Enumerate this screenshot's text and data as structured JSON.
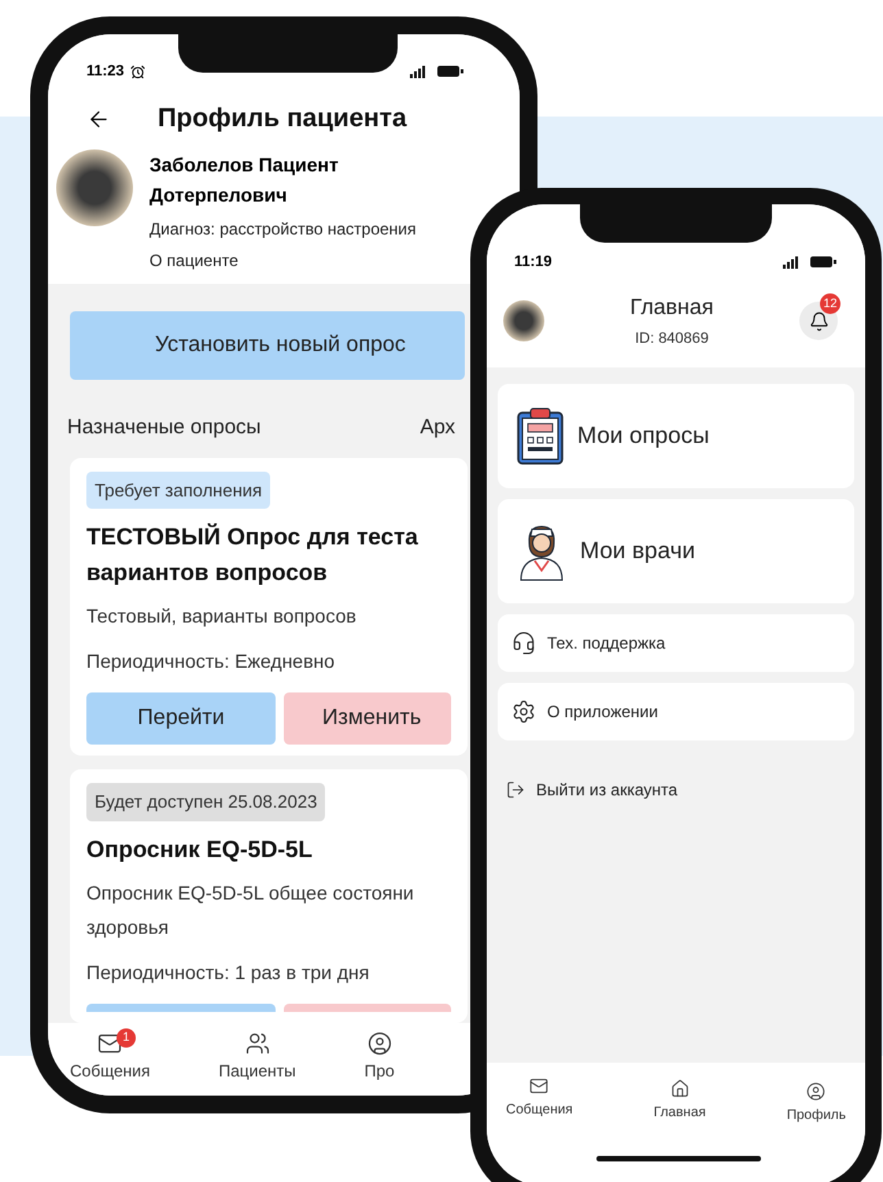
{
  "back_phone": {
    "status_time": "11:23",
    "title": "Профиль пациента",
    "patient": {
      "name": "Заболелов Пациент Дотерпелович",
      "diagnosis": "Диагноз: расстройство настроения",
      "about_link": "О пациенте"
    },
    "new_survey_button": "Установить новый опрос",
    "section_title": "Назначеные опросы",
    "archive_tab": "Арх",
    "surveys": [
      {
        "kind": "pending",
        "status": "Требует заполнения",
        "title": "ТЕСТОВЫЙ Опрос для теста вариантов вопросов",
        "description": [
          "Тестовый, варианты вопросов"
        ],
        "periodicity": "Периодичность: Ежедневно",
        "buttons": [
          "Перейти",
          "Изменить"
        ]
      },
      {
        "kind": "scheduled",
        "status": "Будет доступен 25.08.2023",
        "title": "Опросник EQ-5D-5L",
        "description": [
          "Опросник EQ-5D-5L общее состояни",
          "здоровья"
        ],
        "periodicity": "Периодичность: 1 раз в три дня"
      }
    ],
    "nav": [
      {
        "kind": "messages",
        "label": "Собщения",
        "badge": "1"
      },
      {
        "kind": "patients",
        "label": "Пациенты"
      },
      {
        "kind": "profile",
        "label": "Про"
      }
    ]
  },
  "front_phone": {
    "status_time": "11:19",
    "title": "Главная",
    "user_id": "ID: 840869",
    "notifications": "12",
    "menu": [
      {
        "kind": "large",
        "label": "Мои опросы"
      },
      {
        "kind": "large",
        "label": "Мои врачи"
      },
      {
        "kind": "small",
        "label": "Тех. поддержка"
      },
      {
        "kind": "small",
        "label": "О приложении"
      },
      {
        "kind": "plain",
        "label": "Выйти из аккаунта"
      }
    ],
    "nav": [
      {
        "kind": "messages",
        "label": "Собщения"
      },
      {
        "kind": "home",
        "label": "Главная"
      },
      {
        "kind": "profile",
        "label": "Профиль"
      }
    ]
  }
}
